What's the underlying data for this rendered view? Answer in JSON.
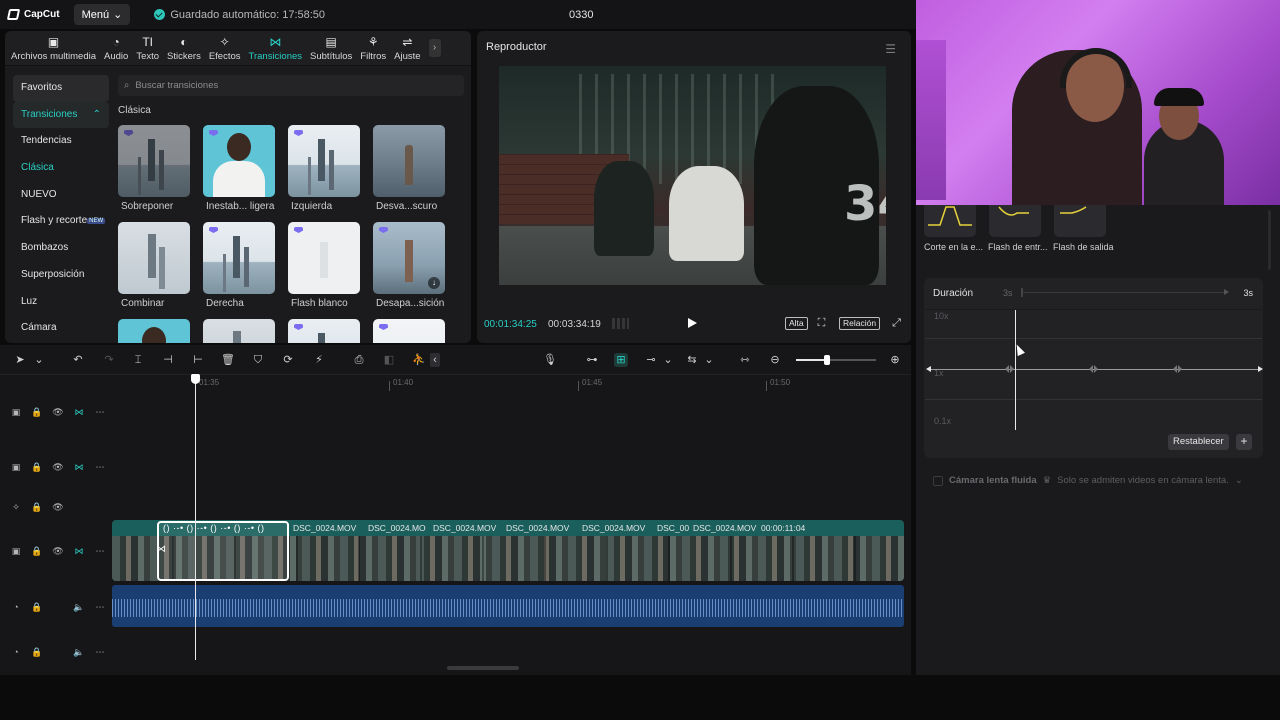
{
  "titlebar": {
    "app_name": "CapCut",
    "menu_label": "Menú",
    "autosave": "Guardado automático: 17:58:50",
    "project_title": "0330"
  },
  "media_tabs": [
    {
      "icon": "media-icon",
      "label": "Archivos multimedia"
    },
    {
      "icon": "audio-icon",
      "label": "Audio"
    },
    {
      "icon": "text-icon",
      "label": "Texto"
    },
    {
      "icon": "sticker-icon",
      "label": "Stickers"
    },
    {
      "icon": "effects-icon",
      "label": "Efectos"
    },
    {
      "icon": "transitions-icon",
      "label": "Transiciones"
    },
    {
      "icon": "subtitles-icon",
      "label": "Subtítulos"
    },
    {
      "icon": "filters-icon",
      "label": "Filtros"
    },
    {
      "icon": "adjust-icon",
      "label": "Ajuste"
    }
  ],
  "sidebar": {
    "items": [
      {
        "label": "Favoritos"
      },
      {
        "label": "Transiciones"
      },
      {
        "label": "Tendencias"
      },
      {
        "label": "Clásica"
      },
      {
        "label": "NUEVO"
      },
      {
        "label": "Flash y recorte",
        "badge": "NEW"
      },
      {
        "label": "Bombazos"
      },
      {
        "label": "Superposición"
      },
      {
        "label": "Luz"
      },
      {
        "label": "Cámara"
      }
    ]
  },
  "search": {
    "placeholder": "Buscar transiciones"
  },
  "section_title": "Clásica",
  "transitions": [
    {
      "label": "Sobreponer"
    },
    {
      "label": "Inestab... ligera"
    },
    {
      "label": "Izquierda"
    },
    {
      "label": "Desva...scuro"
    },
    {
      "label": "Combinar"
    },
    {
      "label": "Derecha"
    },
    {
      "label": "Flash blanco"
    },
    {
      "label": "Desapa...sición"
    }
  ],
  "player": {
    "title": "Reproductor",
    "current_time": "00:01:34:25",
    "total_time": "00:03:34:19",
    "quality_btn": "Alta",
    "ratio_btn": "Relación",
    "jersey_number": "34"
  },
  "animations": [
    {
      "label": "Corte en la e..."
    },
    {
      "label": "Flash de entr..."
    },
    {
      "label": "Flash de salida"
    }
  ],
  "speed": {
    "duration_label": "Duración",
    "duration_min": "3s",
    "duration_max": "3s",
    "y_top": "10x",
    "y_mid": "1x",
    "y_bottom": "0.1x",
    "reset_label": "Restablecer",
    "add_label": "+",
    "smooth_label": "Cámara lenta fluida",
    "smooth_note": "Solo se admiten videos en cámara lenta."
  },
  "timeline": {
    "ruler": [
      "01:35",
      "01:40",
      "01:45",
      "01:50"
    ],
    "clips": [
      {
        "label": "DSC_0024.MOV"
      },
      {
        "label": "DSC_0024.MO"
      },
      {
        "label": "DSC_0024.MOV"
      },
      {
        "label": "DSC_0024.MOV"
      },
      {
        "label": "DSC_0024.MOV"
      },
      {
        "label": "DSC_00"
      },
      {
        "label": "DSC_0024.MOV"
      },
      {
        "label": "00:00:11:04"
      }
    ]
  }
}
